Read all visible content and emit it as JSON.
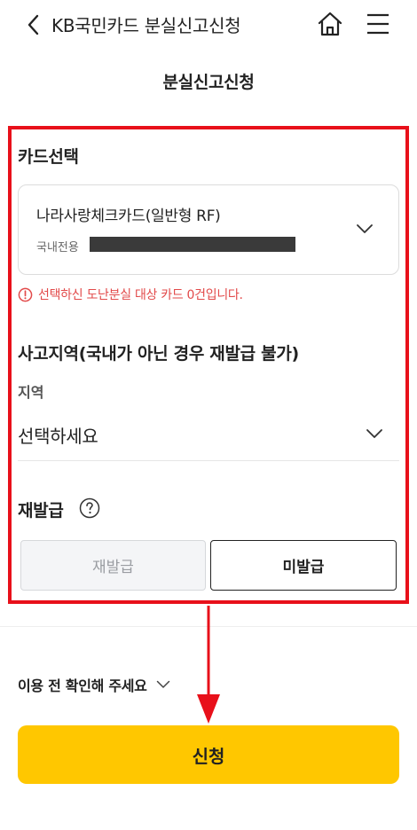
{
  "header": {
    "title": "KB국민카드 분실신고신청",
    "back_icon": "chevron-left-icon",
    "home_icon": "home-icon",
    "menu_icon": "hamburger-menu-icon"
  },
  "page_title": "분실신고신청",
  "card_section": {
    "label": "카드선택",
    "selected_card_name": "나라사랑체크카드(일반형 RF)",
    "selected_card_sub_label": "국내전용",
    "error_message": "선택하신 도난분실 대상 카드 0건입니다."
  },
  "region_section": {
    "label": "사고지역(국내가 아닌 경우 재발급 불가)",
    "field_label": "지역",
    "selected_value": "선택하세요"
  },
  "reissue_section": {
    "label": "재발급",
    "options": [
      "재발급",
      "미발급"
    ],
    "selected": "미발급"
  },
  "notice": {
    "label": "이용 전 확인해 주세요"
  },
  "submit_label": "신청",
  "colors": {
    "accent": "#ffc700",
    "highlight_border": "#e8101a",
    "error": "#e24a4a"
  }
}
